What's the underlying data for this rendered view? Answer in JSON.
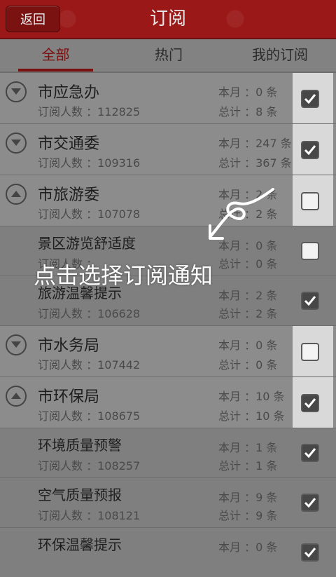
{
  "header": {
    "back_label": "返回",
    "title": "订阅"
  },
  "tabs": [
    {
      "label": "全部"
    },
    {
      "label": "热门"
    },
    {
      "label": "我的订阅"
    }
  ],
  "items": [
    {
      "name": "市应急办",
      "subscribers": "订阅人数 ：112825",
      "month": "本月 ：0 条",
      "total": "总计 ：8 条",
      "checked": true
    },
    {
      "name": "市交通委",
      "subscribers": "订阅人数 ：109316",
      "month": "本月 ：247 条",
      "total": "总计 ：367 条",
      "checked": true
    },
    {
      "name": "市旅游委",
      "subscribers": "订阅人数 ：107078",
      "month": "本月 ：2 条",
      "total": "总计 ：2 条",
      "checked": false
    },
    {
      "name": "景区游览舒适度",
      "subscribers": "订阅人数 ：",
      "month": "本月 ：0 条",
      "total": "总计 ：0 条",
      "checked": false
    },
    {
      "name": "旅游温馨提示",
      "subscribers": "订阅人数 ：106628",
      "month": "本月 ：2 条",
      "total": "总计 ：2 条",
      "checked": true
    },
    {
      "name": "市水务局",
      "subscribers": "订阅人数 ：107442",
      "month": "本月 ：0 条",
      "total": "总计 ：0 条",
      "checked": false
    },
    {
      "name": "市环保局",
      "subscribers": "订阅人数 ：108675",
      "month": "本月 ：10 条",
      "total": "总计 ：10 条",
      "checked": true
    },
    {
      "name": "环境质量预警",
      "subscribers": "订阅人数 ：108257",
      "month": "本月 ：1 条",
      "total": "总计 ：1 条",
      "checked": true
    },
    {
      "name": "空气质量预报",
      "subscribers": "订阅人数 ：108121",
      "month": "本月 ：9 条",
      "total": "总计 ：9 条",
      "checked": true
    },
    {
      "name": "环保温馨提示",
      "subscribers": "",
      "month": "本月 ：0 条",
      "total": "",
      "checked": true
    }
  ],
  "overlay": {
    "hint": "点击选择订阅通知"
  }
}
